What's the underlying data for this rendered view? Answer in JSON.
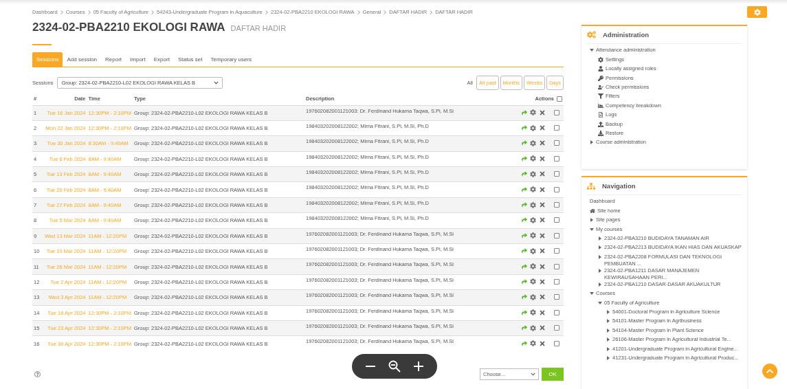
{
  "breadcrumb": [
    "Dashboard",
    "Courses",
    "05 Faculty of Agriculture",
    "54243-Undergraduate Program in Aquaculture",
    "2324-02-PBA2210 EKOLOGI RAWA",
    "General",
    "DAFTAR HADIR",
    "DAFTAR HADIR"
  ],
  "title": "2324-02-PBA2210 EKOLOGI RAWA",
  "subtitle": "DAFTAR HADIR",
  "tabs": [
    {
      "label": "Sessions",
      "selected": true
    },
    {
      "label": "Add session",
      "selected": false
    },
    {
      "label": "Report",
      "selected": false
    },
    {
      "label": "Import",
      "selected": false
    },
    {
      "label": "Export",
      "selected": false
    },
    {
      "label": "Status set",
      "selected": false
    },
    {
      "label": "Temporary users",
      "selected": false
    }
  ],
  "sessions_filter": {
    "label": "Sessions",
    "value": "Group: 2324-02-PBA2210-L02 EKOLOGI RAWA KELAS B"
  },
  "view_filters": [
    {
      "label": "All",
      "selected": true
    },
    {
      "label": "All past",
      "selected": false
    },
    {
      "label": "Months",
      "selected": false
    },
    {
      "label": "Weeks",
      "selected": false
    },
    {
      "label": "Days",
      "selected": false
    }
  ],
  "table": {
    "columns": [
      "#",
      "Date",
      "Time",
      "Type",
      "Description",
      "Actions"
    ],
    "select_all_checked": false,
    "rows": [
      {
        "num": "1",
        "date": "Tue 16 Jan 2024",
        "time": "12:30PM - 2:10PM",
        "type": "Group: 2324-02-PBA2210-L02 EKOLOGI RAWA KELAS B",
        "description": "197602082001121003: Dr. Ferdinand Hukama Taqwa, S.Pi, M.Si",
        "checked": false
      },
      {
        "num": "2",
        "date": "Mon 22 Jan 2024",
        "time": "12:30PM - 2:10PM",
        "type": "Group: 2324-02-PBA2210-L02 EKOLOGI RAWA KELAS B",
        "description": "198403202008122002; Mirna Fitrani, S.Pi, M.Si, Ph.D",
        "checked": false
      },
      {
        "num": "3",
        "date": "Tue 30 Jan 2024",
        "time": "8:30AM - 9:40AM",
        "type": "Group: 2324-02-PBA2210-L02 EKOLOGI RAWA KELAS B",
        "description": "198403202008122002; Mirna Fitrani, S.Pi, M.Si, Ph.D",
        "checked": false
      },
      {
        "num": "4",
        "date": "Tue 6 Feb 2024",
        "time": "8AM - 9:40AM",
        "type": "Group: 2324-02-PBA2210-L02 EKOLOGI RAWA KELAS B",
        "description": "198403202008122002; Mirna Fitrani, S.Pi, M.Si, Ph.D",
        "checked": false
      },
      {
        "num": "5",
        "date": "Tue 13 Feb 2024",
        "time": "8AM - 9:40AM",
        "type": "Group: 2324-02-PBA2210-L02 EKOLOGI RAWA KELAS B",
        "description": "198403202008122002; Mirna Fitrani, S.Pi, M.Si, Ph.D",
        "checked": false
      },
      {
        "num": "6",
        "date": "Tue 20 Feb 2024",
        "time": "8AM - 9:40AM",
        "type": "Group: 2324-02-PBA2210-L02 EKOLOGI RAWA KELAS B",
        "description": "198403202008122002; Mirna Fitrani, S.Pi, M.Si, Ph.D",
        "checked": false
      },
      {
        "num": "7",
        "date": "Tue 27 Feb 2024",
        "time": "8AM - 9:40AM",
        "type": "Group: 2324-02-PBA2210-L02 EKOLOGI RAWA KELAS B",
        "description": "198403202008122002; Mirna Fitrani, S.Pi, M.Si, Ph.D",
        "checked": false
      },
      {
        "num": "8",
        "date": "Tue 5 Mar 2024",
        "time": "8AM - 9:40AM",
        "type": "Group: 2324-02-PBA2210-L02 EKOLOGI RAWA KELAS B",
        "description": "198403202008122002; Mirna Fitrani, S.Pi, M.Si, Ph.D",
        "checked": false
      },
      {
        "num": "9",
        "date": "Wed 13 Mar 2024",
        "time": "11AM - 12:20PM",
        "type": "Group: 2324-02-PBA2210-L02 EKOLOGI RAWA KELAS B",
        "description": "197602082001121003; Dr. Ferdinand Hukama Taqwa, S.Pi, M.Si",
        "checked": false
      },
      {
        "num": "10",
        "date": "Tue 19 Mar 2024",
        "time": "11AM - 12:20PM",
        "type": "Group: 2324-02-PBA2210-L02 EKOLOGI RAWA KELAS B",
        "description": "197602082001121003; Dr. Ferdinand Hukama Taqwa, S.Pi, M.Si",
        "checked": false
      },
      {
        "num": "11",
        "date": "Tue 26 Mar 2024",
        "time": "11AM - 12:20PM",
        "type": "Group: 2324-02-PBA2210-L02 EKOLOGI RAWA KELAS B",
        "description": "197602082001121003; Dr. Ferdinand Hukama Taqwa, S.Pi, M.Si",
        "checked": false
      },
      {
        "num": "12",
        "date": "Tue 2 Apr 2024",
        "time": "11AM - 12:20PM",
        "type": "Group: 2324-02-PBA2210-L02 EKOLOGI RAWA KELAS B",
        "description": "197602082001121003; Dr. Ferdinand Hukama Taqwa, S.Pi, M.Si",
        "checked": false
      },
      {
        "num": "13",
        "date": "Wed 3 Apr 2024",
        "time": "11AM - 12:20PM",
        "type": "Group: 2324-02-PBA2210-L02 EKOLOGI RAWA KELAS B",
        "description": "197602082001121003; Dr. Ferdinand Hukama Taqwa, S.Pi, M.Si",
        "checked": false
      },
      {
        "num": "14",
        "date": "Tue 16 Apr 2024",
        "time": "12:30PM - 2:10PM",
        "type": "Group: 2324-02-PBA2210-L02 EKOLOGI RAWA KELAS B",
        "description": "197602082001121003; Dr. Ferdinand Hukama Taqwa, S.Pi, M.Si",
        "checked": false
      },
      {
        "num": "15",
        "date": "Tue 23 Apr 2024",
        "time": "12:30PM - 2:10PM",
        "type": "Group: 2324-02-PBA2210-L02 EKOLOGI RAWA KELAS B",
        "description": "197602082001121003; Dr. Ferdinand Hukama Taqwa, S.Pi, M.Si",
        "checked": false
      },
      {
        "num": "16",
        "date": "Tue 30 Apr 2024",
        "time": "12:30PM - 2:10PM",
        "type": "Group: 2324-02-PBA2210-L02 EKOLOGI RAWA KELAS B",
        "description": "197602082001121003; Dr. Ferdinand Hukama Taqwa, S.Pi, M.Si",
        "checked": false
      }
    ]
  },
  "bulk_action": {
    "placeholder": "Choose...",
    "button": "OK"
  },
  "administration": {
    "title": "Administration",
    "items": [
      {
        "label": "Attendance administration",
        "expanded": true,
        "children": [
          {
            "label": "Settings",
            "kind": "settings"
          },
          {
            "label": "Locally assigned roles",
            "kind": "user"
          },
          {
            "label": "Permissions",
            "kind": "key"
          },
          {
            "label": "Check permissions",
            "kind": "user-check"
          },
          {
            "label": "Filters",
            "kind": "filter"
          },
          {
            "label": "Competency breakdown",
            "kind": "chart"
          },
          {
            "label": "Logs",
            "kind": "logs"
          },
          {
            "label": "Backup",
            "kind": "backup"
          },
          {
            "label": "Restore",
            "kind": "restore"
          }
        ]
      },
      {
        "label": "Course administration",
        "expanded": false
      }
    ]
  },
  "navigation": {
    "title": "Navigation",
    "items": [
      {
        "label": "Dashboard",
        "kind": "plain"
      },
      {
        "label": "Site home",
        "kind": "home"
      },
      {
        "label": "Site pages",
        "expanded": false
      },
      {
        "label": "My courses",
        "expanded": true,
        "children": [
          {
            "label": "2324-02-PBA3210 BUDIDAYA TANAMAN AIR",
            "expanded": false
          },
          {
            "label": "2324-02-PBA2213 BUDIDAYA IKAN HIAS DAN AKUASKAP",
            "expanded": false
          },
          {
            "label": "2324-02-PBA2208 FORMULASI DAN TEKNOLOGI PEMBUATAN ...",
            "expanded": false
          },
          {
            "label": "2324-02-PBA1211 DASAR MANAJEMEN KEWIRAUSAHAAN PERI...",
            "expanded": false
          },
          {
            "label": "2324-02-PBA1210 DASAR-DASAR AKUAKULTUR",
            "expanded": false
          }
        ]
      },
      {
        "label": "Courses",
        "expanded": true,
        "children": [
          {
            "label": "05 Faculty of Agriculture",
            "expanded": true,
            "children": [
              {
                "label": "54001-Doctoral Program in Agriculture Science",
                "expanded": false
              },
              {
                "label": "54101-Master Program in Agribusiness",
                "expanded": false
              },
              {
                "label": "54104-Master Program in Plant Science",
                "expanded": false
              },
              {
                "label": "26106-Master Program in Agricultural Industrial Te...",
                "expanded": false
              },
              {
                "label": "41201-Undergraduate Program in Agricultural Engine...",
                "expanded": false
              },
              {
                "label": "41231-Undergraduate Program in Agricultural Produc...",
                "expanded": false
              }
            ]
          }
        ]
      }
    ]
  }
}
